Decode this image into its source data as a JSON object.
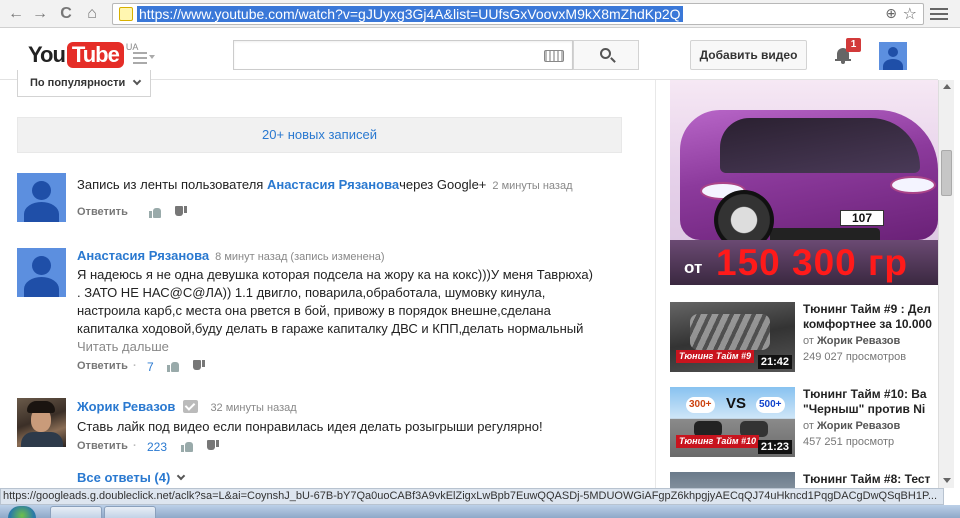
{
  "browser": {
    "url": "https://www.youtube.com/watch?v=gJUyxg3Gj4A&list=UUfsGxVoovxM9kX8mZhdKp2Q",
    "back_glyph": "←",
    "forward_glyph": "→",
    "reload_glyph": "C",
    "home_glyph": "⌂",
    "zoom_glyph": "⊕",
    "star_glyph": "☆"
  },
  "header": {
    "logo_you": "You",
    "logo_tube": "Tube",
    "logo_region": "UA",
    "search_placeholder": "",
    "upload_label": "Добавить видео",
    "notification_count": "1"
  },
  "comments_section": {
    "sort_label": "По популярности",
    "new_posts_label": "20+ новых записей",
    "reply_label": "Ответить",
    "all_replies_label": "Все ответы (4)",
    "comments": [
      {
        "text_prefix": "Запись из ленты пользователя ",
        "text_author": "Анастасия Рязанова",
        "text_suffix": "через Google+",
        "time": "2 минуты назад"
      },
      {
        "author": "Анастасия Рязанова",
        "time": "8 минут назад (запись изменена)",
        "lines": [
          "Я надеюсь я не одна девушка которая подсела на жору ка на кокс)))У меня Таврюха)",
          ". ЗАТО НЕ НАС@С@ЛА)) 1.1 двигло, поварила,обработала, шумовку кинула,",
          "настроила карб,с  места она рвется в бой, привожу в порядок внешне,сделана",
          "капиталка ходовой,буду делать в гараже капиталку ДВС и КПП,делать нормальный"
        ],
        "read_more": "Читать дальше",
        "likes": "7"
      },
      {
        "author": "Жорик Ревазов",
        "time": "32 минуты назад",
        "text": "Ставь лайк под видео если понравилась идея делать розыгрыши регулярно!",
        "likes": "223"
      }
    ]
  },
  "sidebar": {
    "ad": {
      "plate": "107",
      "prefix": "от",
      "price": "150 300 гр"
    },
    "videos": [
      {
        "title_line1": "Тюнинг Тайм #9 : Дел",
        "title_line2": "комфортнее за 10.000",
        "by_prefix": "от ",
        "channel": "Жорик Ревазов",
        "views": "249 027 просмотров",
        "duration": "21:42",
        "thumb_tag": "Тюнинг Тайм #9"
      },
      {
        "title_line1": "Тюнинг Тайм #10: Ва",
        "title_line2": "\"Черныш\" против Ni",
        "by_prefix": "от ",
        "channel": "Жорик Ревазов",
        "views": "457 251 просмотр",
        "duration": "21:23",
        "thumb_tag": "Тюнинг Тайм #10",
        "thumb_vs": "VS",
        "thumb_left": "300+",
        "thumb_right": "500+"
      },
      {
        "title_line1": "Тюнинг Тайм #8: Тест"
      }
    ]
  },
  "statusbar": {
    "text": "https://googleads.g.doubleclick.net/aclk?sa=L&ai=CoynshJ_bU-67B-bY7Qa0uoCABf3A9vkElZigxLwBpb7EuwQQASDj-5MDUOWGiAFgpZ6khpgjyAECqQJ74uHkncd1PqgDACgDwQSqBH1P..."
  },
  "colors": {
    "link_blue": "#2a79d0",
    "logo_red": "#e52d27",
    "badge_red": "#d23a3a",
    "avatar_blue": "#5c8fdf",
    "ad_price_red": "#ff1a1a"
  }
}
